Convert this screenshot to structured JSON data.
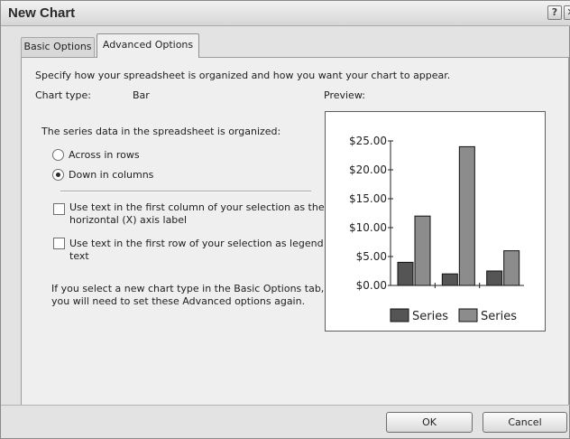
{
  "window": {
    "title": "New Chart",
    "help_glyph": "?",
    "close_glyph": "✕"
  },
  "tabs": [
    {
      "label": "Basic Options",
      "active": false
    },
    {
      "label": "Advanced Options",
      "active": true
    }
  ],
  "advanced": {
    "intro": "Specify how your spreadsheet is organized and how you want your chart to appear.",
    "chart_type_label": "Chart type:",
    "chart_type_value": "Bar",
    "preview_label": "Preview:",
    "organized_label": "The series data in the spreadsheet is organized:",
    "radio_options": [
      {
        "label": "Across in rows",
        "selected": false
      },
      {
        "label": "Down in columns",
        "selected": true
      }
    ],
    "checkboxes": [
      {
        "line1": "Use text in the first column of your selection as the",
        "line2": "horizontal (X) axis label",
        "checked": false
      },
      {
        "line1": "Use text in the first row of your selection as legend",
        "line2": "text",
        "checked": false
      }
    ],
    "note_line1": "If you select a new chart type in the Basic Options tab,",
    "note_line2": "you will need to set these Advanced options again."
  },
  "chart_data": {
    "type": "bar",
    "categories": [
      "",
      "",
      ""
    ],
    "series": [
      {
        "name": "Series",
        "values": [
          4,
          2,
          2.5
        ],
        "color": "#555555"
      },
      {
        "name": "Series",
        "values": [
          12,
          24,
          6
        ],
        "color": "#8c8c8c"
      }
    ],
    "ylim": [
      0,
      25
    ],
    "yticks": [
      "$0.00",
      "$5.00",
      "$10.00",
      "$15.00",
      "$20.00",
      "$25.00"
    ],
    "legend": "bottom"
  },
  "buttons": {
    "ok": "OK",
    "cancel": "Cancel"
  }
}
